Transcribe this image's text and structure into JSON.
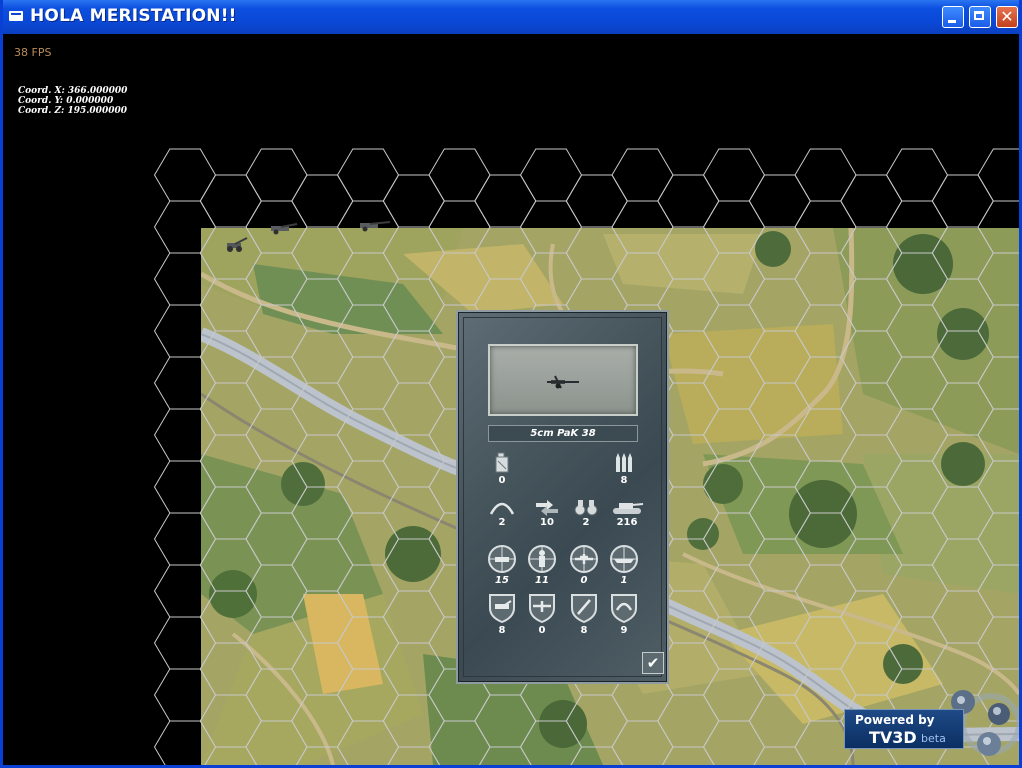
{
  "window": {
    "title": "HOLA MERISTATION!!",
    "close_glyph": "✕"
  },
  "hud": {
    "fps": "38 FPS",
    "coord_x": "Coord. X: 366.000000",
    "coord_y": "Coord. Y: 0.000000",
    "coord_z": "Coord. Z: 195.000000"
  },
  "unit_panel": {
    "unit_name": "5cm PaK 38",
    "stats": {
      "fuel": "0",
      "ammo": "8",
      "range": "2",
      "movement": "10",
      "spotting": "2",
      "cost": "216",
      "hard_attack": "15",
      "soft_attack": "11",
      "air_attack": "0",
      "naval_attack": "1",
      "ground_defense": "8",
      "air_defense": "0",
      "close_defense": "8",
      "initiative": "9"
    },
    "confirm_glyph": "✔"
  },
  "logo": {
    "line1": "Powered by",
    "line2": "TV3D",
    "line3": "beta"
  },
  "colors": {
    "titlebar": "#0a47d4",
    "map_grass": "#a9a765",
    "river": "#b9bfc6",
    "panel": "#47555d"
  }
}
